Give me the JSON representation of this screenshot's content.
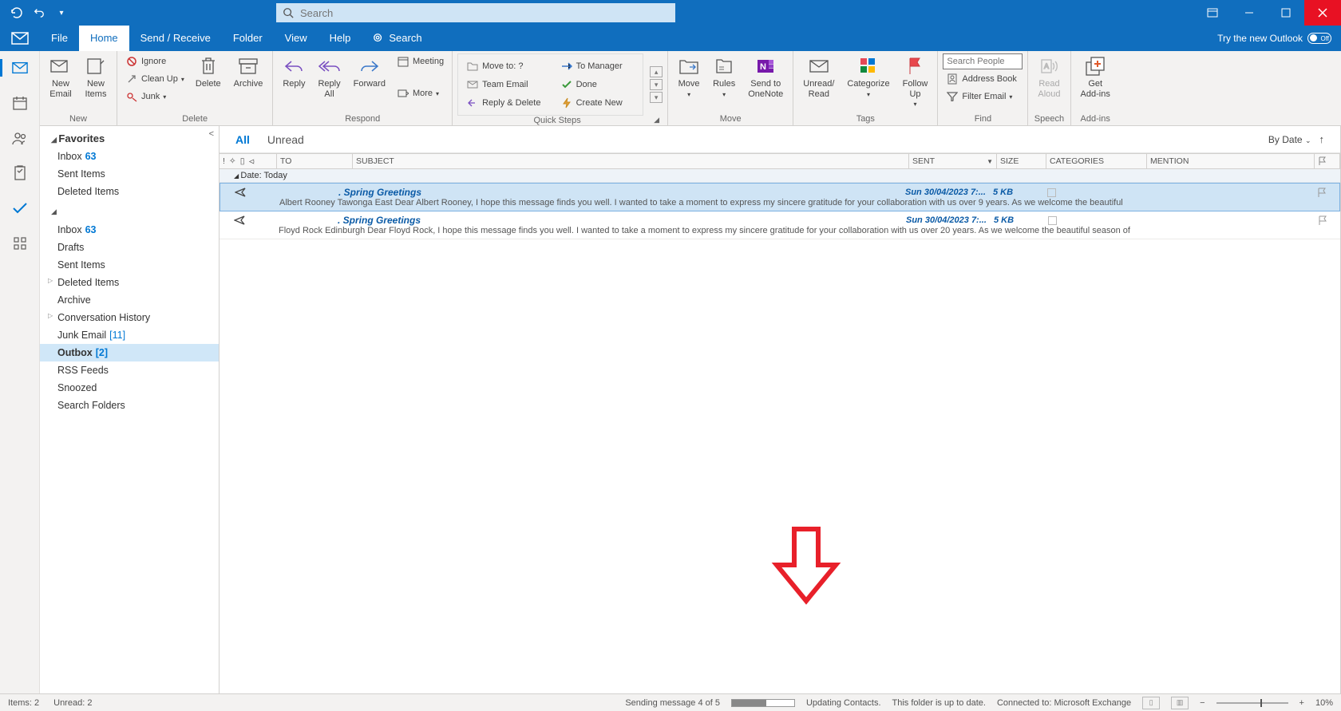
{
  "titlebar": {
    "search_placeholder": "Search"
  },
  "tabs": {
    "file": "File",
    "home": "Home",
    "sendreceive": "Send / Receive",
    "folder": "Folder",
    "view": "View",
    "help": "Help",
    "search": "Search"
  },
  "try_outlook": "Try the new Outlook",
  "toggle_state": "Off",
  "ribbon": {
    "new": {
      "label": "New",
      "new_email": "New\nEmail",
      "new_items": "New\nItems"
    },
    "delete": {
      "label": "Delete",
      "ignore": "Ignore",
      "cleanup": "Clean Up",
      "junk": "Junk",
      "delete_btn": "Delete",
      "archive": "Archive"
    },
    "respond": {
      "label": "Respond",
      "reply": "Reply",
      "reply_all": "Reply\nAll",
      "forward": "Forward",
      "meeting": "Meeting",
      "more": "More"
    },
    "quicksteps": {
      "label": "Quick Steps",
      "move_to": "Move to: ?",
      "to_manager": "To Manager",
      "team_email": "Team Email",
      "done": "Done",
      "reply_delete": "Reply & Delete",
      "create_new": "Create New"
    },
    "move": {
      "label": "Move",
      "move_btn": "Move",
      "rules": "Rules",
      "onenote": "Send to\nOneNote"
    },
    "tags": {
      "label": "Tags",
      "unread": "Unread/\nRead",
      "categorize": "Categorize",
      "followup": "Follow\nUp"
    },
    "find": {
      "label": "Find",
      "search_people_ph": "Search People",
      "address_book": "Address Book",
      "filter_email": "Filter Email"
    },
    "speech": {
      "label": "Speech",
      "read_aloud": "Read\nAloud"
    },
    "addins": {
      "label": "Add-ins",
      "get_addins": "Get\nAdd-ins"
    }
  },
  "folders": {
    "favorites": "Favorites",
    "fav_items": [
      {
        "name": "Inbox",
        "count": "63"
      },
      {
        "name": "Sent Items"
      },
      {
        "name": "Deleted Items"
      }
    ],
    "items": [
      {
        "name": "Inbox",
        "count": "63"
      },
      {
        "name": "Drafts"
      },
      {
        "name": "Sent Items"
      },
      {
        "name": "Deleted Items",
        "expandable": true
      },
      {
        "name": "Archive"
      },
      {
        "name": "Conversation History",
        "expandable": true
      },
      {
        "name": "Junk Email",
        "bracket": "[11]"
      },
      {
        "name": "Outbox",
        "bracket": "[2]",
        "selected": true,
        "bold": true
      },
      {
        "name": "RSS Feeds"
      },
      {
        "name": "Snoozed"
      },
      {
        "name": "Search Folders"
      }
    ]
  },
  "filter": {
    "all": "All",
    "unread": "Unread",
    "by_date": "By Date"
  },
  "columns": {
    "to": "TO",
    "subject": "SUBJECT",
    "sent": "SENT",
    "size": "SIZE",
    "categories": "CATEGORIES",
    "mention": "MENTION"
  },
  "group_today": "Date: Today",
  "messages": [
    {
      "subject": ". Spring Greetings",
      "sent": "Sun 30/04/2023 7:...",
      "size": "5 KB",
      "preview": "Albert Rooney   Tawonga East   Dear Albert Rooney,   I hope this message finds you well. I wanted to take a moment to express my sincere gratitude for your collaboration with us over 9 years.   As we welcome the beautiful",
      "selected": true
    },
    {
      "subject": ". Spring Greetings",
      "sent": "Sun 30/04/2023 7:...",
      "size": "5 KB",
      "preview": "Floyd Rock   Edinburgh   Dear Floyd Rock,   I hope this message finds you well. I wanted to take a moment to express my sincere gratitude for your collaboration with us over 20 years.   As we welcome the beautiful season of",
      "selected": false
    }
  ],
  "status": {
    "items": "Items: 2",
    "unread": "Unread: 2",
    "sending": "Sending message 4 of 5",
    "updating": "Updating Contacts.",
    "folder_status": "This folder is up to date.",
    "connected": "Connected to: Microsoft Exchange",
    "zoom": "10%"
  }
}
